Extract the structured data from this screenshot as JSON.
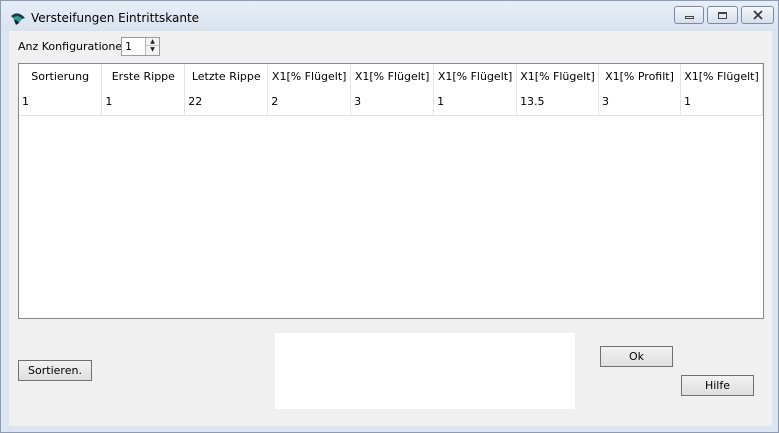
{
  "window": {
    "title": "Versteifungen Eintrittskante",
    "app_icon": "wing-glider-icon",
    "controls": {
      "minimize": "▭",
      "maximize": "▣",
      "close": "✕"
    }
  },
  "config": {
    "label": "Anz Konfigurationen",
    "value": "1"
  },
  "table": {
    "columns": [
      "Sortierung",
      "Erste Rippe",
      "Letzte Rippe",
      "X1[% Flügelt]",
      "X1[% Flügelt]",
      "X1[% Flügelt]",
      "X1[% Flügelt]",
      "X1[% Profilt]",
      "X1[% Flügelt]"
    ],
    "rows": [
      [
        "1",
        "1",
        "22",
        "2",
        "3",
        "1",
        "13.5",
        "3",
        "1"
      ]
    ]
  },
  "buttons": {
    "sort": "Sortieren.",
    "ok": "Ok",
    "help": "Hilfe"
  }
}
